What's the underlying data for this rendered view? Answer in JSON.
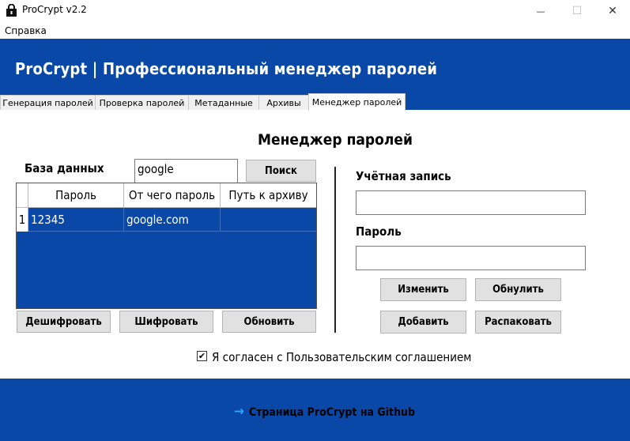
{
  "window": {
    "title": "ProCrypt v2.2",
    "minimize_glyph": "—",
    "maximize_glyph": "☐",
    "close_glyph": "✕"
  },
  "menu": {
    "items": [
      "Справка"
    ]
  },
  "header": {
    "title": "ProCrypt | Профессиональный менеджер паролей"
  },
  "tabs": [
    {
      "label": "Генерация паролей"
    },
    {
      "label": "Проверка паролей"
    },
    {
      "label": "Метаданные"
    },
    {
      "label": "Архивы"
    },
    {
      "label": "Менеджер паролей",
      "active": true
    }
  ],
  "main": {
    "title": "Менеджер паролей",
    "db_label": "База данных",
    "search_value": "google",
    "search_button": "Поиск",
    "table": {
      "columns": [
        "Пароль",
        "От чего пароль",
        "Путь к архиву"
      ],
      "rows": [
        {
          "index": "1",
          "cells": [
            "12345",
            "google.com",
            ""
          ]
        }
      ]
    },
    "buttons_left": [
      "Дешифровать",
      "Шифровать",
      "Обновить"
    ],
    "account_label": "Учётная запись",
    "account_value": "",
    "password_label": "Пароль",
    "password_value": "",
    "buttons_right": [
      "Изменить",
      "Обнулить",
      "Добавить",
      "Распаковать"
    ],
    "consent_checked": true,
    "consent_text": "Я согласен с Пользовательским соглашением"
  },
  "footer": {
    "link_arrow": "→",
    "link_text": "Страница ProCrypt на Github"
  },
  "colors": {
    "brand_blue": "#0a48a8",
    "link_arrow": "#2fa6ff"
  },
  "icons": {
    "app": "procrypt-lock-icon"
  }
}
